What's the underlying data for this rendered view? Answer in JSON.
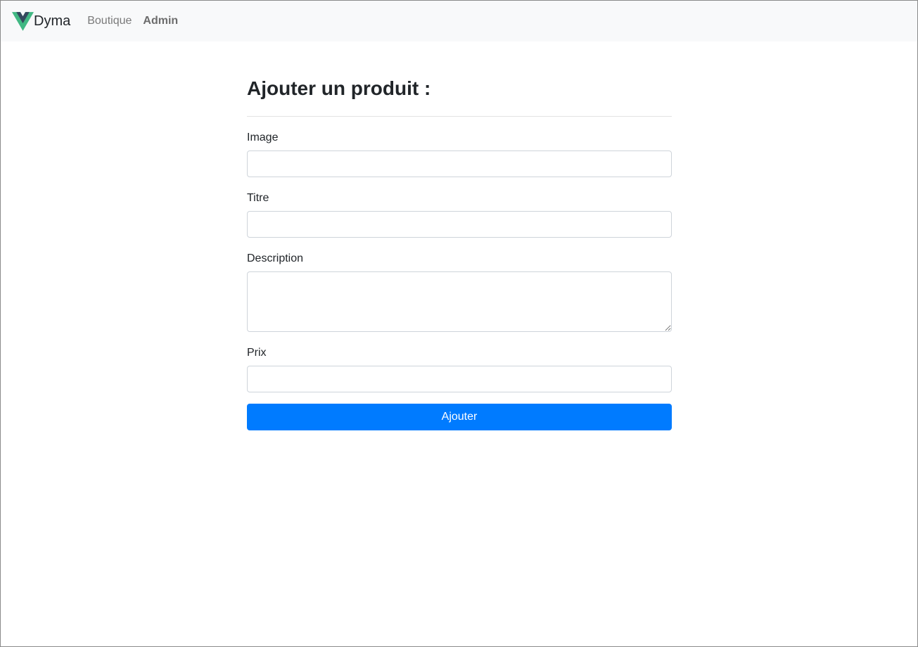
{
  "navbar": {
    "brand": {
      "name": "Dyma",
      "logo_icon": "vue-logo-icon"
    },
    "links": [
      {
        "label": "Boutique",
        "active": false
      },
      {
        "label": "Admin",
        "active": true
      }
    ]
  },
  "form": {
    "title": "Ajouter un produit :",
    "fields": {
      "image": {
        "label": "Image",
        "value": "",
        "placeholder": ""
      },
      "titre": {
        "label": "Titre",
        "value": "",
        "placeholder": ""
      },
      "description": {
        "label": "Description",
        "value": "",
        "placeholder": ""
      },
      "prix": {
        "label": "Prix",
        "value": "",
        "placeholder": ""
      }
    },
    "submit_label": "Ajouter"
  },
  "colors": {
    "navbar_bg": "#f8f9fa",
    "primary": "#007bff",
    "logo_green": "#41b883",
    "logo_dark": "#35495e"
  }
}
